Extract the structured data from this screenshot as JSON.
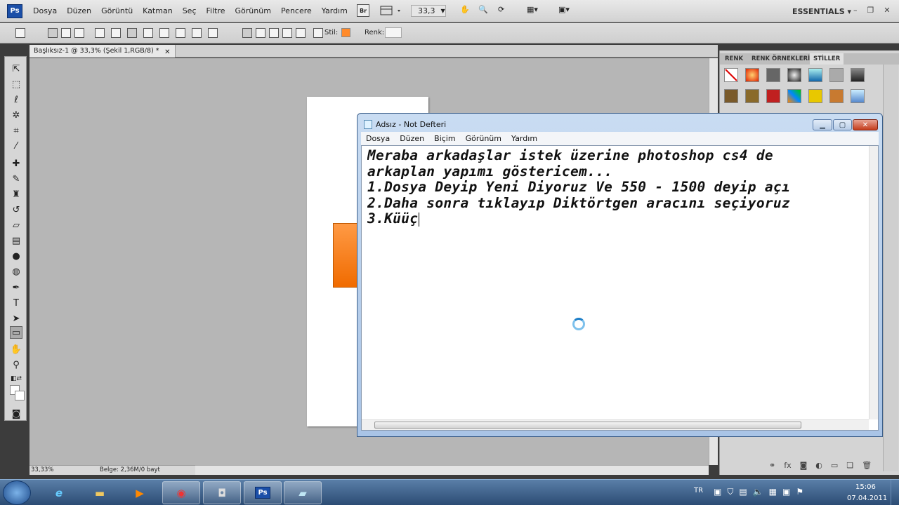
{
  "photoshop": {
    "logo": "Ps",
    "menus": [
      "Dosya",
      "Düzen",
      "Görüntü",
      "Katman",
      "Seç",
      "Filtre",
      "Görünüm",
      "Pencere",
      "Yardım"
    ],
    "bridge_label": "Br",
    "zoom_value": "33,3",
    "workspace": "ESSENTIALS",
    "options": {
      "style_label": "Stil:",
      "color_label": "Renk:",
      "style_color": "#ff8a2a"
    },
    "document_tab": "Başlıksız-1 @ 33,3% (Şekil 1,RGB/8) *",
    "status": {
      "zoom": "33,33%",
      "doc_size": "Belge: 2,36M/0 bayt"
    },
    "panel_tabs": [
      "RENK",
      "RENK ÖRNEKLERİ",
      "STİLLER"
    ],
    "active_panel": "STİLLER"
  },
  "notepad": {
    "title": "Adsız - Not Defteri",
    "menus": [
      "Dosya",
      "Düzen",
      "Biçim",
      "Görünüm",
      "Yardım"
    ],
    "lines": [
      "Meraba arkadaşlar istek üzerine photoshop cs4 de",
      "arkaplan yapımı göstericem...",
      "1.Dosya Deyip Yeni Diyoruz Ve 550 - 1500 deyip açı",
      "2.Daha sonra tıklayıp Diktörtgen aracını seçiyoruz",
      "3.Küüç"
    ]
  },
  "taskbar": {
    "language": "TR",
    "time": "15:06",
    "date": "07.04.2011",
    "apps": [
      "ie-icon",
      "explorer-icon",
      "media-player-icon",
      "chrome-icon",
      "camera-icon",
      "photoshop-icon",
      "notepad-icon"
    ]
  },
  "colors": {
    "orange": "#f07a1a",
    "taskbar": "#2c4c74"
  }
}
